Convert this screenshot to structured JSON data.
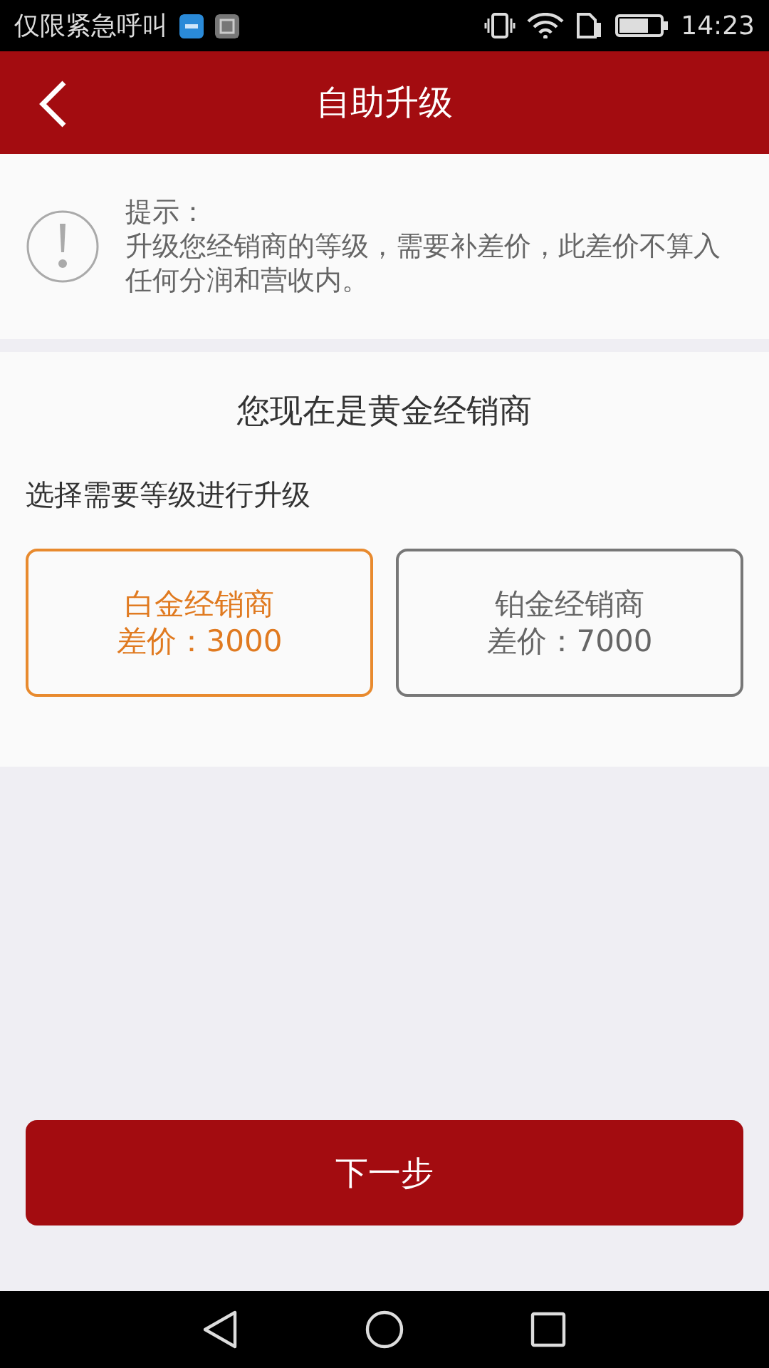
{
  "status_bar": {
    "carrier": "仅限紧急呼叫",
    "time": "14:23"
  },
  "header": {
    "title": "自助升级"
  },
  "tip": {
    "label": "提示：",
    "text": "升级您经销商的等级，需要补差价，此差价不算入任何分润和营收内。"
  },
  "current_level": "您现在是黄金经销商",
  "prompt": "选择需要等级进行升级",
  "options": [
    {
      "name": "白金经销商",
      "price": "差价：3000",
      "selected": true
    },
    {
      "name": "铂金经销商",
      "price": "差价：7000",
      "selected": false
    }
  ],
  "next_button": "下一步"
}
